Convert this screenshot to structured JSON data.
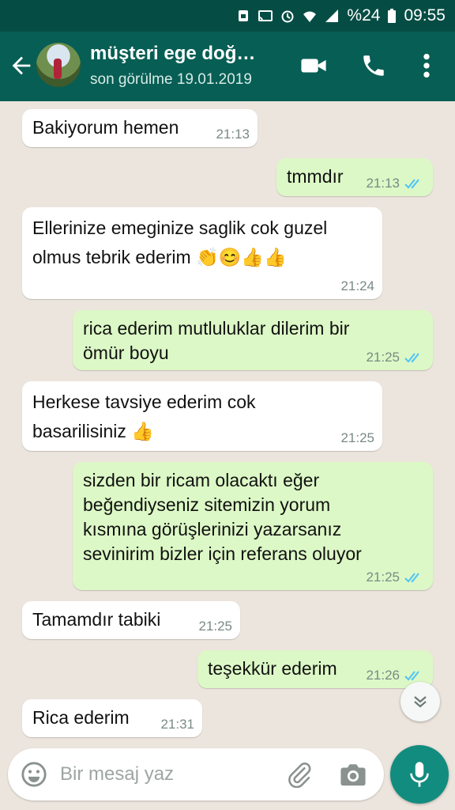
{
  "status_bar": {
    "battery": "%24",
    "time": "09:55"
  },
  "header": {
    "contact_name": "müşteri ege doğ…",
    "last_seen": "son görülme 19.01.2019"
  },
  "messages": [
    {
      "direction": "in",
      "text": "Bakiyorum hemen",
      "time": "21:13"
    },
    {
      "direction": "out",
      "text": "tmmdır",
      "time": "21:13"
    },
    {
      "direction": "in",
      "text": "Ellerinize emeginize saglik cok guzel\nolmus tebrik ederim 👏😊👍👍",
      "time": "21:24"
    },
    {
      "direction": "out",
      "text": "rica ederim mutluluklar dilerim bir\nömür boyu",
      "time": "21:25"
    },
    {
      "direction": "in",
      "text": "Herkese tavsiye ederim cok\nbasarilisiniz 👍",
      "time": "21:25"
    },
    {
      "direction": "out",
      "text": "sizden bir ricam olacaktı eğer\nbeğendiyseniz sitemizin yorum\nkısmına görüşlerinizi yazarsanız\nsevinirim bizler için referans oluyor",
      "time": "21:25"
    },
    {
      "direction": "in",
      "text": "Tamamdır tabiki",
      "time": "21:25"
    },
    {
      "direction": "out",
      "text": "teşekkür ederim",
      "time": "21:26"
    },
    {
      "direction": "in",
      "text": "Rica ederim",
      "time": "21:31"
    }
  ],
  "composer": {
    "placeholder": "Bir mesaj yaz",
    "value": ""
  },
  "icons": {
    "back": "arrow-left-icon",
    "video": "video-camera-icon",
    "call": "phone-icon",
    "more": "more-vertical-icon",
    "emoji": "emoji-icon",
    "attach": "paperclip-icon",
    "camera": "camera-icon",
    "mic": "microphone-icon",
    "scroll": "chevron-double-down-icon",
    "read": "double-check-icon"
  },
  "colors": {
    "header": "#075e54",
    "status_bar": "#054d44",
    "outgoing_bubble": "#dcf8c6",
    "incoming_bubble": "#ffffff",
    "chat_background": "#ece5dd",
    "read_ticks": "#4fc3f7",
    "mic_button": "#128c7e"
  }
}
